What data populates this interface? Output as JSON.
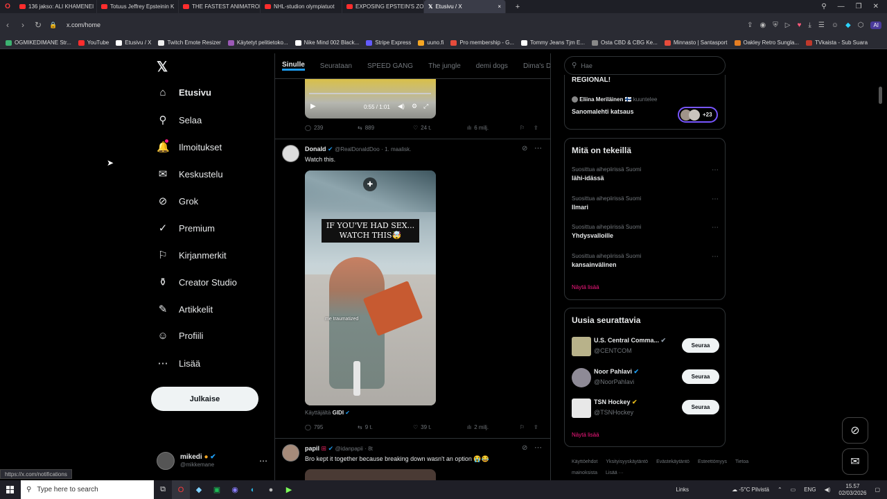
{
  "browser": {
    "tabs": [
      {
        "title": "136 jakso: ALI KHAMENEI",
        "type": "yt"
      },
      {
        "title": "Totuus Jeffrey Epsteinin K",
        "type": "yt"
      },
      {
        "title": "THE FASTEST ANIMATRON",
        "type": "yt"
      },
      {
        "title": "NHL-studion olympiatuot",
        "type": "yt"
      },
      {
        "title": "EXPOSING EPSTEIN'S ZOR",
        "type": "yt"
      },
      {
        "title": "Etusivu / X",
        "type": "x"
      }
    ],
    "url": "x.com/home",
    "bookmarks": [
      {
        "label": "OGMIKEDIMANE Str...",
        "color": "#3cb371"
      },
      {
        "label": "YouTube",
        "color": "#ff2d2d"
      },
      {
        "label": "Etusivu / X",
        "color": "#ffffff"
      },
      {
        "label": "Twitch Emote Resizer",
        "color": "#eeeeee"
      },
      {
        "label": "Käytetyt pelitietoko...",
        "color": "#9b59b6"
      },
      {
        "label": "Nike Mind 002 Black...",
        "color": "#ffffff"
      },
      {
        "label": "Stripe Express",
        "color": "#635bff"
      },
      {
        "label": "uuno.fi",
        "color": "#f5a623"
      },
      {
        "label": "Pro membership - G...",
        "color": "#e74c3c"
      },
      {
        "label": "Tommy Jeans Tjm E...",
        "color": "#ffffff"
      },
      {
        "label": "Osta CBD & CBG Ke...",
        "color": "#888888"
      },
      {
        "label": "Minnasto | Santasport",
        "color": "#e74c3c"
      },
      {
        "label": "Oakley Retro Sungla...",
        "color": "#e67e22"
      },
      {
        "label": "TVkaista - Sub Suara",
        "color": "#c0392b"
      }
    ]
  },
  "nav": {
    "items": [
      {
        "label": "Etusivu",
        "icon": "home-icon",
        "glyph": "⌂"
      },
      {
        "label": "Selaa",
        "icon": "search-icon",
        "glyph": "⚲"
      },
      {
        "label": "Ilmoitukset",
        "icon": "bell-icon",
        "glyph": "🔔"
      },
      {
        "label": "Keskustelu",
        "icon": "mail-icon",
        "glyph": "✉"
      },
      {
        "label": "Grok",
        "icon": "grok-icon",
        "glyph": "⊘"
      },
      {
        "label": "Premium",
        "icon": "verified-icon",
        "glyph": "✓"
      },
      {
        "label": "Kirjanmerkit",
        "icon": "bookmark-icon",
        "glyph": "⚐"
      },
      {
        "label": "Creator Studio",
        "icon": "creator-icon",
        "glyph": "⚱"
      },
      {
        "label": "Artikkelit",
        "icon": "article-icon",
        "glyph": "✎"
      },
      {
        "label": "Profiili",
        "icon": "profile-icon",
        "glyph": "☺"
      },
      {
        "label": "Lisää",
        "icon": "more-icon",
        "glyph": "⋯"
      }
    ],
    "post_label": "Julkaise",
    "account_name": "mikedi",
    "account_handle": "@mikkemane",
    "status_url": "https://x.com/notifications"
  },
  "feed": {
    "tabs": [
      "Sinulle",
      "Seurataan",
      "SPEED GANG",
      "The jungle",
      "demi dogs",
      "Dima's Dist"
    ],
    "prev_tweet": {
      "video_time": "0:55 / 1:01",
      "replies": "239",
      "reposts": "889",
      "likes": "24 t.",
      "views": "6 milj."
    },
    "tweet": {
      "name": "Donald",
      "handle": "@RealDonaldDoo",
      "time": "· 1. maalisk.",
      "text": "Watch this.",
      "media_caption": "IF YOU'VE HAD SEX... WATCH THIS🤯",
      "media_subtext": "me traumatized",
      "attribution": "Käyttäjältä",
      "attribution_user": "GIDI",
      "replies": "795",
      "reposts": "9 t.",
      "likes": "39 t.",
      "views": "2 milj."
    },
    "next_tweet": {
      "name": "papil",
      "handle": "@idanpapii",
      "time": "· 8t",
      "text": "Bro kept it together because breaking down wasn't an option 😭😂"
    }
  },
  "right": {
    "search_placeholder": "Hae",
    "space": {
      "title": "REGIONAL!",
      "host": "Eliina Meriläinen 🇫🇮",
      "host_action": "kuuntelee",
      "space_name": "Sanomalehti katsaus",
      "listeners": "+23"
    },
    "trends_title": "Mitä on tekeillä",
    "trends": [
      {
        "context": "Suosittua aihepiirissä Suomi",
        "name": "lähi-idässä"
      },
      {
        "context": "Suosittua aihepiirissä Suomi",
        "name": "Ilmari"
      },
      {
        "context": "Suosittua aihepiirissä Suomi",
        "name": "Yhdysvalloille"
      },
      {
        "context": "Suosittua aihepiirissä Suomi",
        "name": "kansainvälinen"
      }
    ],
    "show_more": "Näytä lisää",
    "follow_title": "Uusia seurattavia",
    "suggestions": [
      {
        "name": "U.S. Central Comma...",
        "handle": "@CENTCOM",
        "badge": "#8b98a5"
      },
      {
        "name": "Noor Pahlavi",
        "handle": "@NoorPahlavi",
        "badge": "#1d9bf0"
      },
      {
        "name": "TSN Hockey",
        "handle": "@TSNHockey",
        "badge": "#e2b719"
      }
    ],
    "follow_label": "Seuraa",
    "footer_links": [
      "Käyttöehdot",
      "Yksityisyyskäytäntö",
      "Evästekäytäntö",
      "Esteettömyys",
      "Tietoa mainoksista",
      "Lisää ···"
    ]
  },
  "taskbar": {
    "search_placeholder": "Type here to search",
    "links": "Links",
    "weather": "-5°C Pilvistä",
    "lang": "ENG",
    "time": "15.57",
    "date": "02/03/2026"
  },
  "colors": {
    "accent": "#f91880",
    "verified": "#1d9bf0",
    "border": "#2f3336"
  }
}
